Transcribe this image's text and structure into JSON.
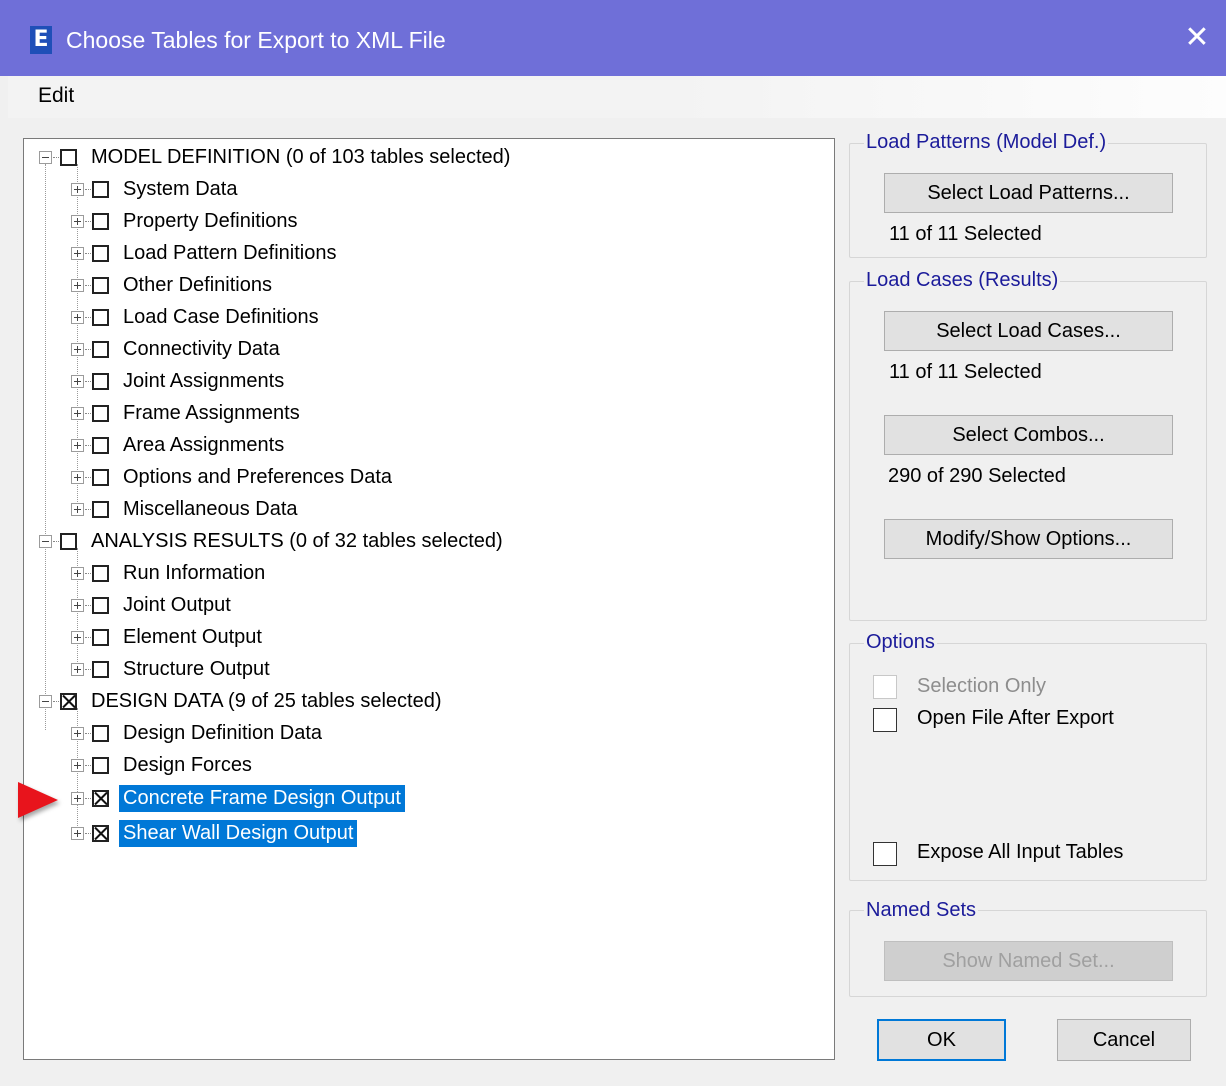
{
  "window": {
    "icon_letter": "E",
    "title": "Choose Tables for Export to XML File",
    "close_glyph": "✕"
  },
  "menu": {
    "edit": "Edit"
  },
  "tree": {
    "groups": [
      {
        "label": "MODEL DEFINITION  (0 of 103 tables selected)",
        "checked": false,
        "expanded": true,
        "children": [
          "System Data",
          "Property Definitions",
          "Load Pattern Definitions",
          "Other Definitions",
          "Load Case Definitions",
          "Connectivity Data",
          "Joint Assignments",
          "Frame Assignments",
          "Area Assignments",
          "Options and Preferences Data",
          "Miscellaneous Data"
        ]
      },
      {
        "label": "ANALYSIS RESULTS  (0 of 32 tables selected)",
        "checked": false,
        "expanded": true,
        "children": [
          "Run Information",
          "Joint Output",
          "Element Output",
          "Structure Output"
        ]
      },
      {
        "label": "DESIGN DATA  (9 of 25 tables selected)",
        "checked": true,
        "expanded": true,
        "children": [
          "Design Definition Data",
          "Design Forces",
          "Concrete Frame Design Output",
          "Shear Wall Design Output"
        ]
      }
    ]
  },
  "load_patterns": {
    "title": "Load Patterns (Model Def.)",
    "button": "Select Load Patterns...",
    "status": "11 of 11 Selected"
  },
  "load_cases": {
    "title": "Load Cases (Results)",
    "button": "Select Load Cases...",
    "status": "11 of 11 Selected",
    "combos_button": "Select Combos...",
    "combos_status": "290 of 290 Selected",
    "options_button": "Modify/Show Options..."
  },
  "options": {
    "title": "Options",
    "selection_only": "Selection Only",
    "open_after_export": "Open File After Export",
    "expose_all": "Expose All Input Tables"
  },
  "named_sets": {
    "title": "Named Sets",
    "button": "Show Named Set..."
  },
  "footer": {
    "ok": "OK",
    "cancel": "Cancel"
  },
  "colors": {
    "titlebar": "#6f6fd8",
    "selection": "#0078d7",
    "group_title": "#1b1b9a",
    "arrow": "#e8141c"
  }
}
